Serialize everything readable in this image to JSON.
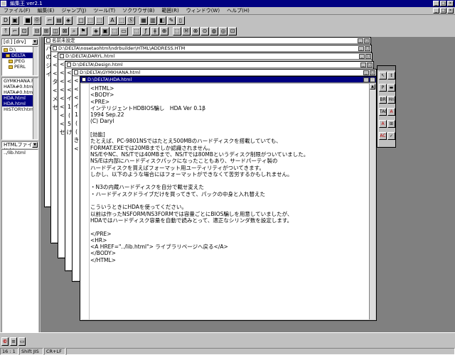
{
  "window": {
    "title": "編集王 ver2.1",
    "min": "_",
    "max": "□",
    "close": "×"
  },
  "menu": [
    "ファイル(F)",
    "編集(E)",
    "ジャンプ(J)",
    "ツール(T)",
    "ソクワウザ(B)",
    "範囲(R)",
    "ウィンドウ(W)",
    "ヘルプ(H)"
  ],
  "toolbar1": [
    "D",
    "▣",
    "■",
    "Ⓞ",
    "⌐",
    "▤",
    "◈",
    "□",
    "⬚",
    "⬚",
    "A",
    "⬚",
    "Ⓢ",
    "▦",
    "▥",
    "◧",
    "✎",
    "▯"
  ],
  "toolbar2": [
    "⤒",
    "⌐",
    "⊡",
    "⊟",
    "⊞",
    "◫",
    "⊠",
    "⌕",
    "⚑",
    "◈",
    "▣",
    "⬚",
    "▭",
    "⬚",
    "ƒ",
    "ǂ",
    "⊕",
    "⬚",
    "Ⓜ",
    "⊗",
    "⊙",
    "◍",
    "◎",
    "⊡"
  ],
  "left_panel": {
    "drive_combo": "[d:] [drv]",
    "folders": [
      "D:\\",
      "DELTA",
      "JPEG",
      "PERL"
    ],
    "files": [
      "GYMKHANA.html",
      "HATA#0.html",
      "HATA#0.html",
      "HDA.html",
      "HDA.html",
      "HISTORY.html"
    ],
    "selected_file_indexes": [
      3,
      4
    ],
    "filter_combo": "HTMLファイル(*.ht",
    "path": "../lib.html"
  },
  "windows": [
    {
      "title": "名前未設定",
      "strip": "ハ\nの\nジ\nイ"
    },
    {
      "title": "D:\\DELTA\\nosetaohtml\\ndrbuilder\\HTML\\ADDRESS.HTM",
      "strip": "<\n<\n<\nタ\n<\nメ\nセ"
    },
    {
      "title": "D:\\DELTA\\DARYL.html",
      "strip": "<\n<\n<\n<\n<\n<\n<\n<\nセ"
    },
    {
      "title": "D:\\DELTA\\Design.html",
      "strip": "<\n<\n<\nイ\n1\n(\n5\nけ"
    },
    {
      "title": "D:\\DELTA\\GYMKHANA.html",
      "strip": "<\n<\n<\nイ\n1\n(\n(\nき\n<"
    }
  ],
  "editor": {
    "title": "D:\\DELTA\\HDA.html",
    "lines": [
      "<HTML>",
      "<BODY>",
      "<PRE>",
      "インテリジェントHDBIOS騙し　HDA Ver 0.1β",
      "1994 Sep.22",
      "(C) Daryl",
      "",
      "[効能]",
      "たとえば、PC-9801NSではたとえ500MBのハードディスクを搭載していても、",
      "FORMAT.EXEでは20MBまでしか認識されません。",
      "NS/EやNC、NS/Tでは40MBまで、NS/Tでは80MBというディスク制限がついていました。",
      "NS/Eは内部にハードディスクパックになったこともあり、サードパーティ製の",
      "ハードディスクを買えばフォーマット用ユーティリティがついてきます。",
      "しかし、以下のような場合にはフォーマットができなくて苦労するかもしれません。",
      "",
      "・N3の内蔵ハードディスクを自分で載せ変えた",
      "・ハードディスクドライブだけを買ってきて、パックの中身と入れ替えた",
      "",
      "こういうときにHDAを使ってください。",
      "以前は作ったNSFORM/NS3FORMでは容量ごとにBIOS騙しを用意していましたが、",
      "HDAではハードディスク容量を自動で読みとって、適正なシリンダ数を設定します。",
      "",
      "</PRE>",
      "<HR>",
      "<A HREF=\"../lib.html\"> ライブラリページへ戻る</A>",
      "</BODY>",
      "</HTML>"
    ]
  },
  "palette": [
    "↖",
    "↕",
    "P",
    "▬",
    "BR",
    "Hn",
    "TAG",
    "A",
    "A",
    "⊞",
    "AC",
    "✓"
  ],
  "status": {
    "position": "16 : 1",
    "encoding": "Shift JIS",
    "newline": "CR+LF"
  },
  "colors": {
    "title_active": "#000080",
    "face": "#c0c0c0",
    "workspace": "#808080",
    "red_button": "#c00000"
  }
}
